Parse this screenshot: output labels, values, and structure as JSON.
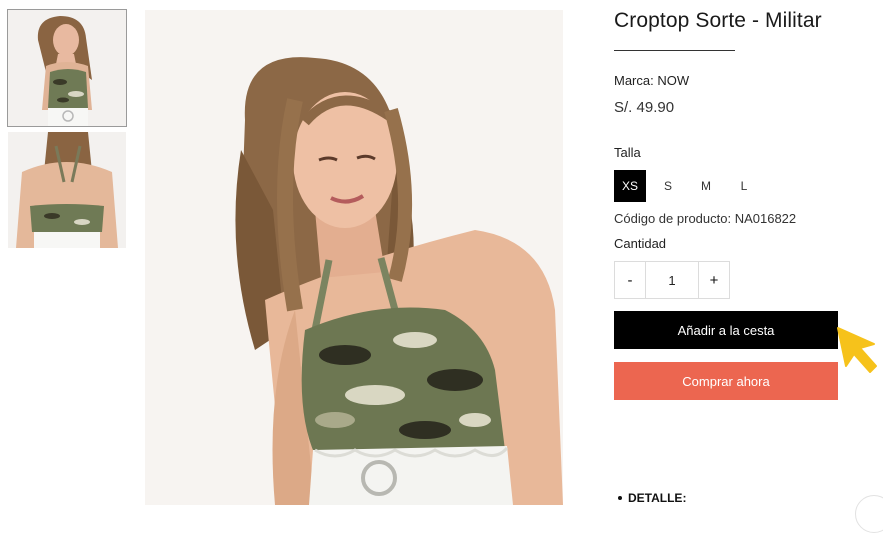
{
  "product": {
    "title": "Croptop Sorte - Militar",
    "brand": "Marca: NOW",
    "price": "S/. 49.90",
    "size_label": "Talla",
    "sizes": [
      {
        "label": "XS",
        "selected": true
      },
      {
        "label": "S",
        "selected": false
      },
      {
        "label": "M",
        "selected": false
      },
      {
        "label": "L",
        "selected": false
      }
    ],
    "code": "Código de producto: NA016822",
    "quantity_label": "Cantidad",
    "quantity": {
      "minus": "-",
      "value": "1",
      "plus": "+"
    },
    "add_to_cart": "Añadir a la cesta",
    "buy_now": "Comprar ahora",
    "detail_heading": "DETALLE:"
  },
  "gallery": {
    "thumbnails": [
      "front-view",
      "back-view"
    ],
    "zoom_icon": "zoom-in-icon"
  },
  "colors": {
    "buy_button": "#ec6650",
    "add_button": "#000000",
    "cursor_highlight": "#f6c21b"
  }
}
